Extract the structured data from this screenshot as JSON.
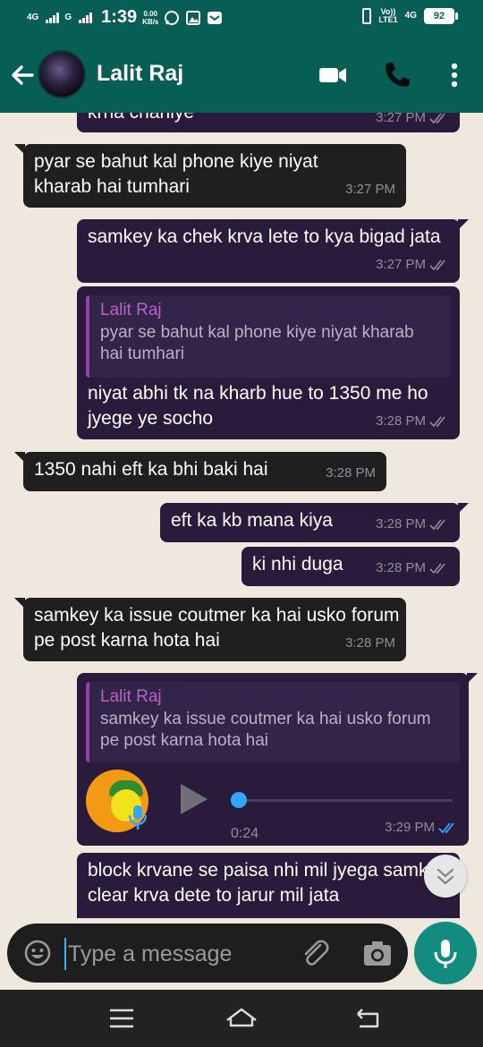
{
  "status_bar": {
    "net1": "4G",
    "net2": "G",
    "time": "1:39",
    "speed_value": "0.00",
    "speed_unit": "KB/s",
    "volte_top": "Vo))",
    "volte_bottom": "LTE1",
    "net3": "4G",
    "battery": "92"
  },
  "header": {
    "contact_name": "Lalit Raj"
  },
  "messages": [
    {
      "direction": "out",
      "text": "krna chahiye",
      "time": "3:27 PM"
    },
    {
      "direction": "in",
      "text": "pyar se bahut kal phone kiye niyat kharab hai tumhari",
      "time": "3:27 PM"
    },
    {
      "direction": "out",
      "text": "samkey ka chek krva lete to kya bigad jata",
      "time": "3:27 PM"
    },
    {
      "direction": "out",
      "quote": {
        "name": "Lalit Raj",
        "text": "pyar se bahut kal phone kiye niyat kharab hai tumhari"
      },
      "text": "niyat abhi tk na kharb hue to 1350 me ho jyege ye socho",
      "time": "3:28 PM"
    },
    {
      "direction": "in",
      "text": "1350 nahi eft ka bhi baki hai",
      "time": "3:28 PM"
    },
    {
      "direction": "out",
      "text": "eft ka kb mana kiya",
      "time": "3:28 PM"
    },
    {
      "direction": "out",
      "text": "ki nhi duga",
      "time": "3:28 PM"
    },
    {
      "direction": "in",
      "text": "samkey ka issue coutmer ka hai usko forum pe post karna hota hai",
      "time": "3:28 PM"
    },
    {
      "direction": "out",
      "quote": {
        "name": "Lalit Raj",
        "text": "samkey ka issue coutmer ka hai usko forum pe post karna hota hai"
      },
      "voice": {
        "duration": "0:24",
        "progress": 0
      },
      "time": "3:29 PM",
      "read": true
    },
    {
      "direction": "out",
      "text": "block krvane se paisa nhi mil jyega samkey clear krva dete to jarur mil jata",
      "time": ""
    }
  ],
  "composer": {
    "placeholder": "Type a message"
  },
  "colors": {
    "header": "#075e54",
    "bubble_out": "#2a1b3d",
    "bubble_in": "#1f1f1f",
    "quote_name": "#b265c4",
    "read_tick": "#2ea7ff",
    "mic_button": "#128c7e"
  },
  "icons": [
    "back-arrow-icon",
    "video-call-icon",
    "phone-call-icon",
    "more-options-icon",
    "emoji-icon",
    "attach-icon",
    "camera-icon",
    "mic-icon",
    "scroll-down-icon",
    "nav-menu-icon",
    "nav-home-icon",
    "nav-back-icon"
  ]
}
